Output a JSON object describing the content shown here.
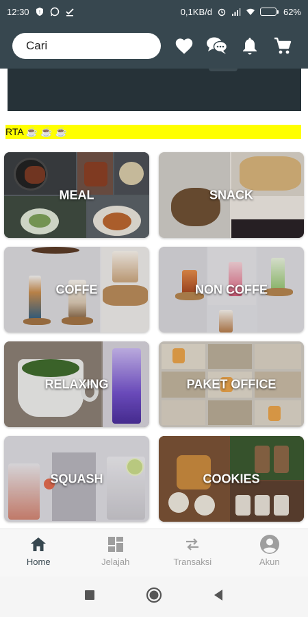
{
  "status": {
    "time": "12:30",
    "speed": "0,1KB/d",
    "battery": "62%",
    "battery_level": 0.62
  },
  "header": {
    "search_value": "Cari",
    "icons": [
      "heart-icon",
      "chat-icon",
      "bell-icon",
      "cart-icon"
    ]
  },
  "marquee": {
    "text": "RTA ☕ ☕ ☕"
  },
  "categories": [
    {
      "label": "MEAL"
    },
    {
      "label": "SNACK"
    },
    {
      "label": "COFFE"
    },
    {
      "label": "NON COFFE"
    },
    {
      "label": "RELAXING"
    },
    {
      "label": "PAKET OFFICE"
    },
    {
      "label": "SQUASH"
    },
    {
      "label": "COOKIES"
    }
  ],
  "bottom_nav": [
    {
      "label": "Home",
      "icon": "home-icon",
      "active": true
    },
    {
      "label": "Jelajah",
      "icon": "dashboard-icon",
      "active": false
    },
    {
      "label": "Transaksi",
      "icon": "swap-icon",
      "active": false
    },
    {
      "label": "Akun",
      "icon": "account-icon",
      "active": false
    }
  ],
  "colors": {
    "primary": "#37474f",
    "banner": "#263238",
    "marquee_bg": "#ffff00"
  }
}
